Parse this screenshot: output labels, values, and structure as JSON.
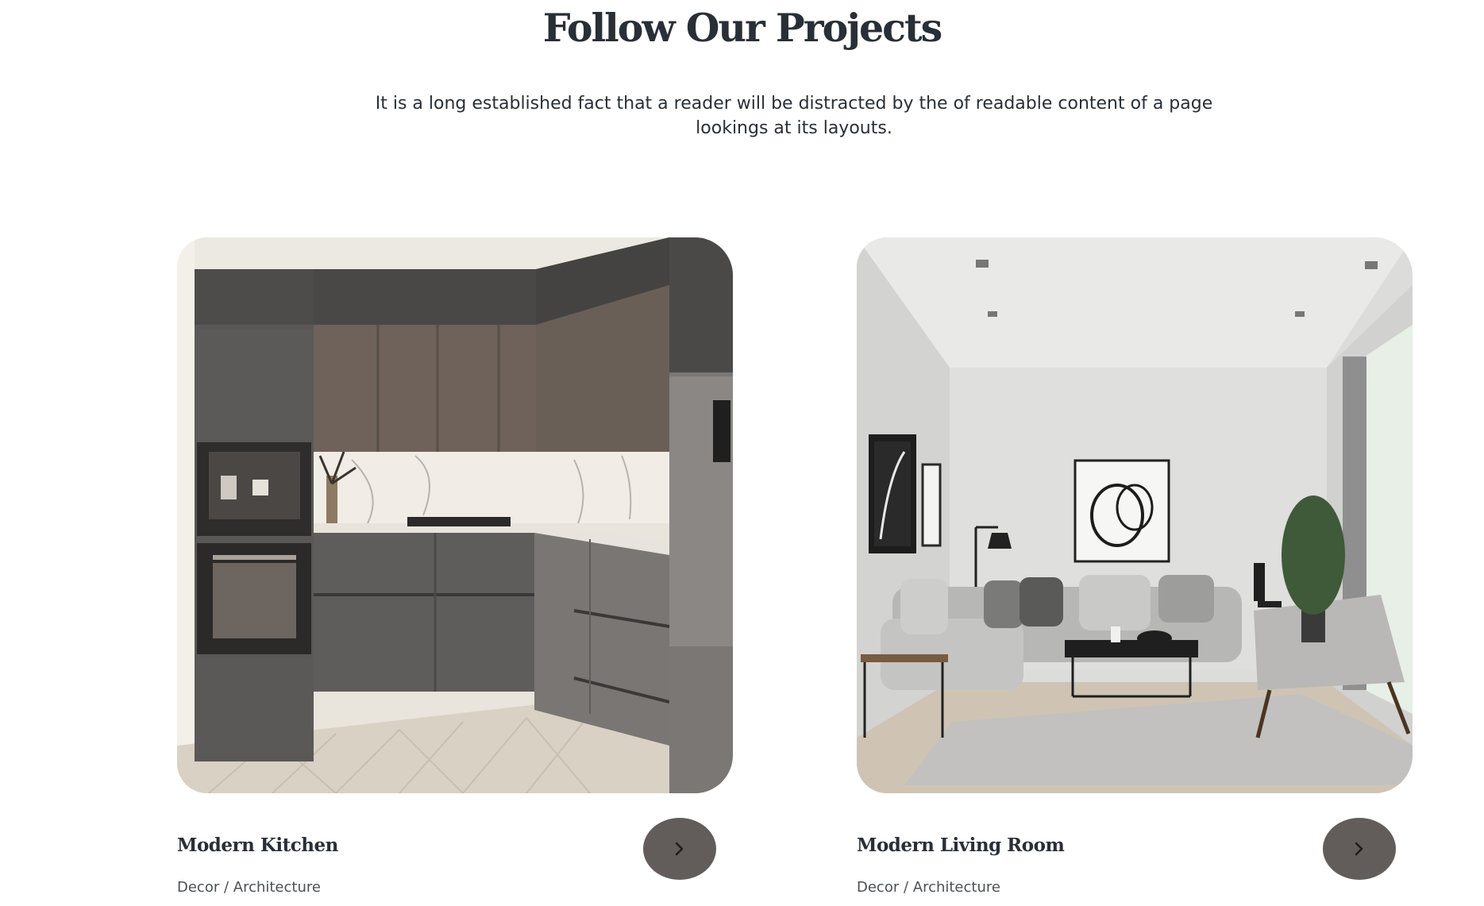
{
  "section": {
    "title": "Follow Our Projects",
    "description": "It is a long established fact that a reader will be distracted by the of readable content of a page lookings at its layouts."
  },
  "projects": [
    {
      "title": "Modern Kitchen",
      "category": "Decor / Architecture",
      "button_icon": "chevron-right-icon"
    },
    {
      "title": "Modern Living Room",
      "category": "Decor / Architecture",
      "button_icon": "chevron-right-icon"
    }
  ],
  "colors": {
    "heading": "#292f36",
    "button": "#625d5a",
    "subtext": "#4d5053"
  }
}
